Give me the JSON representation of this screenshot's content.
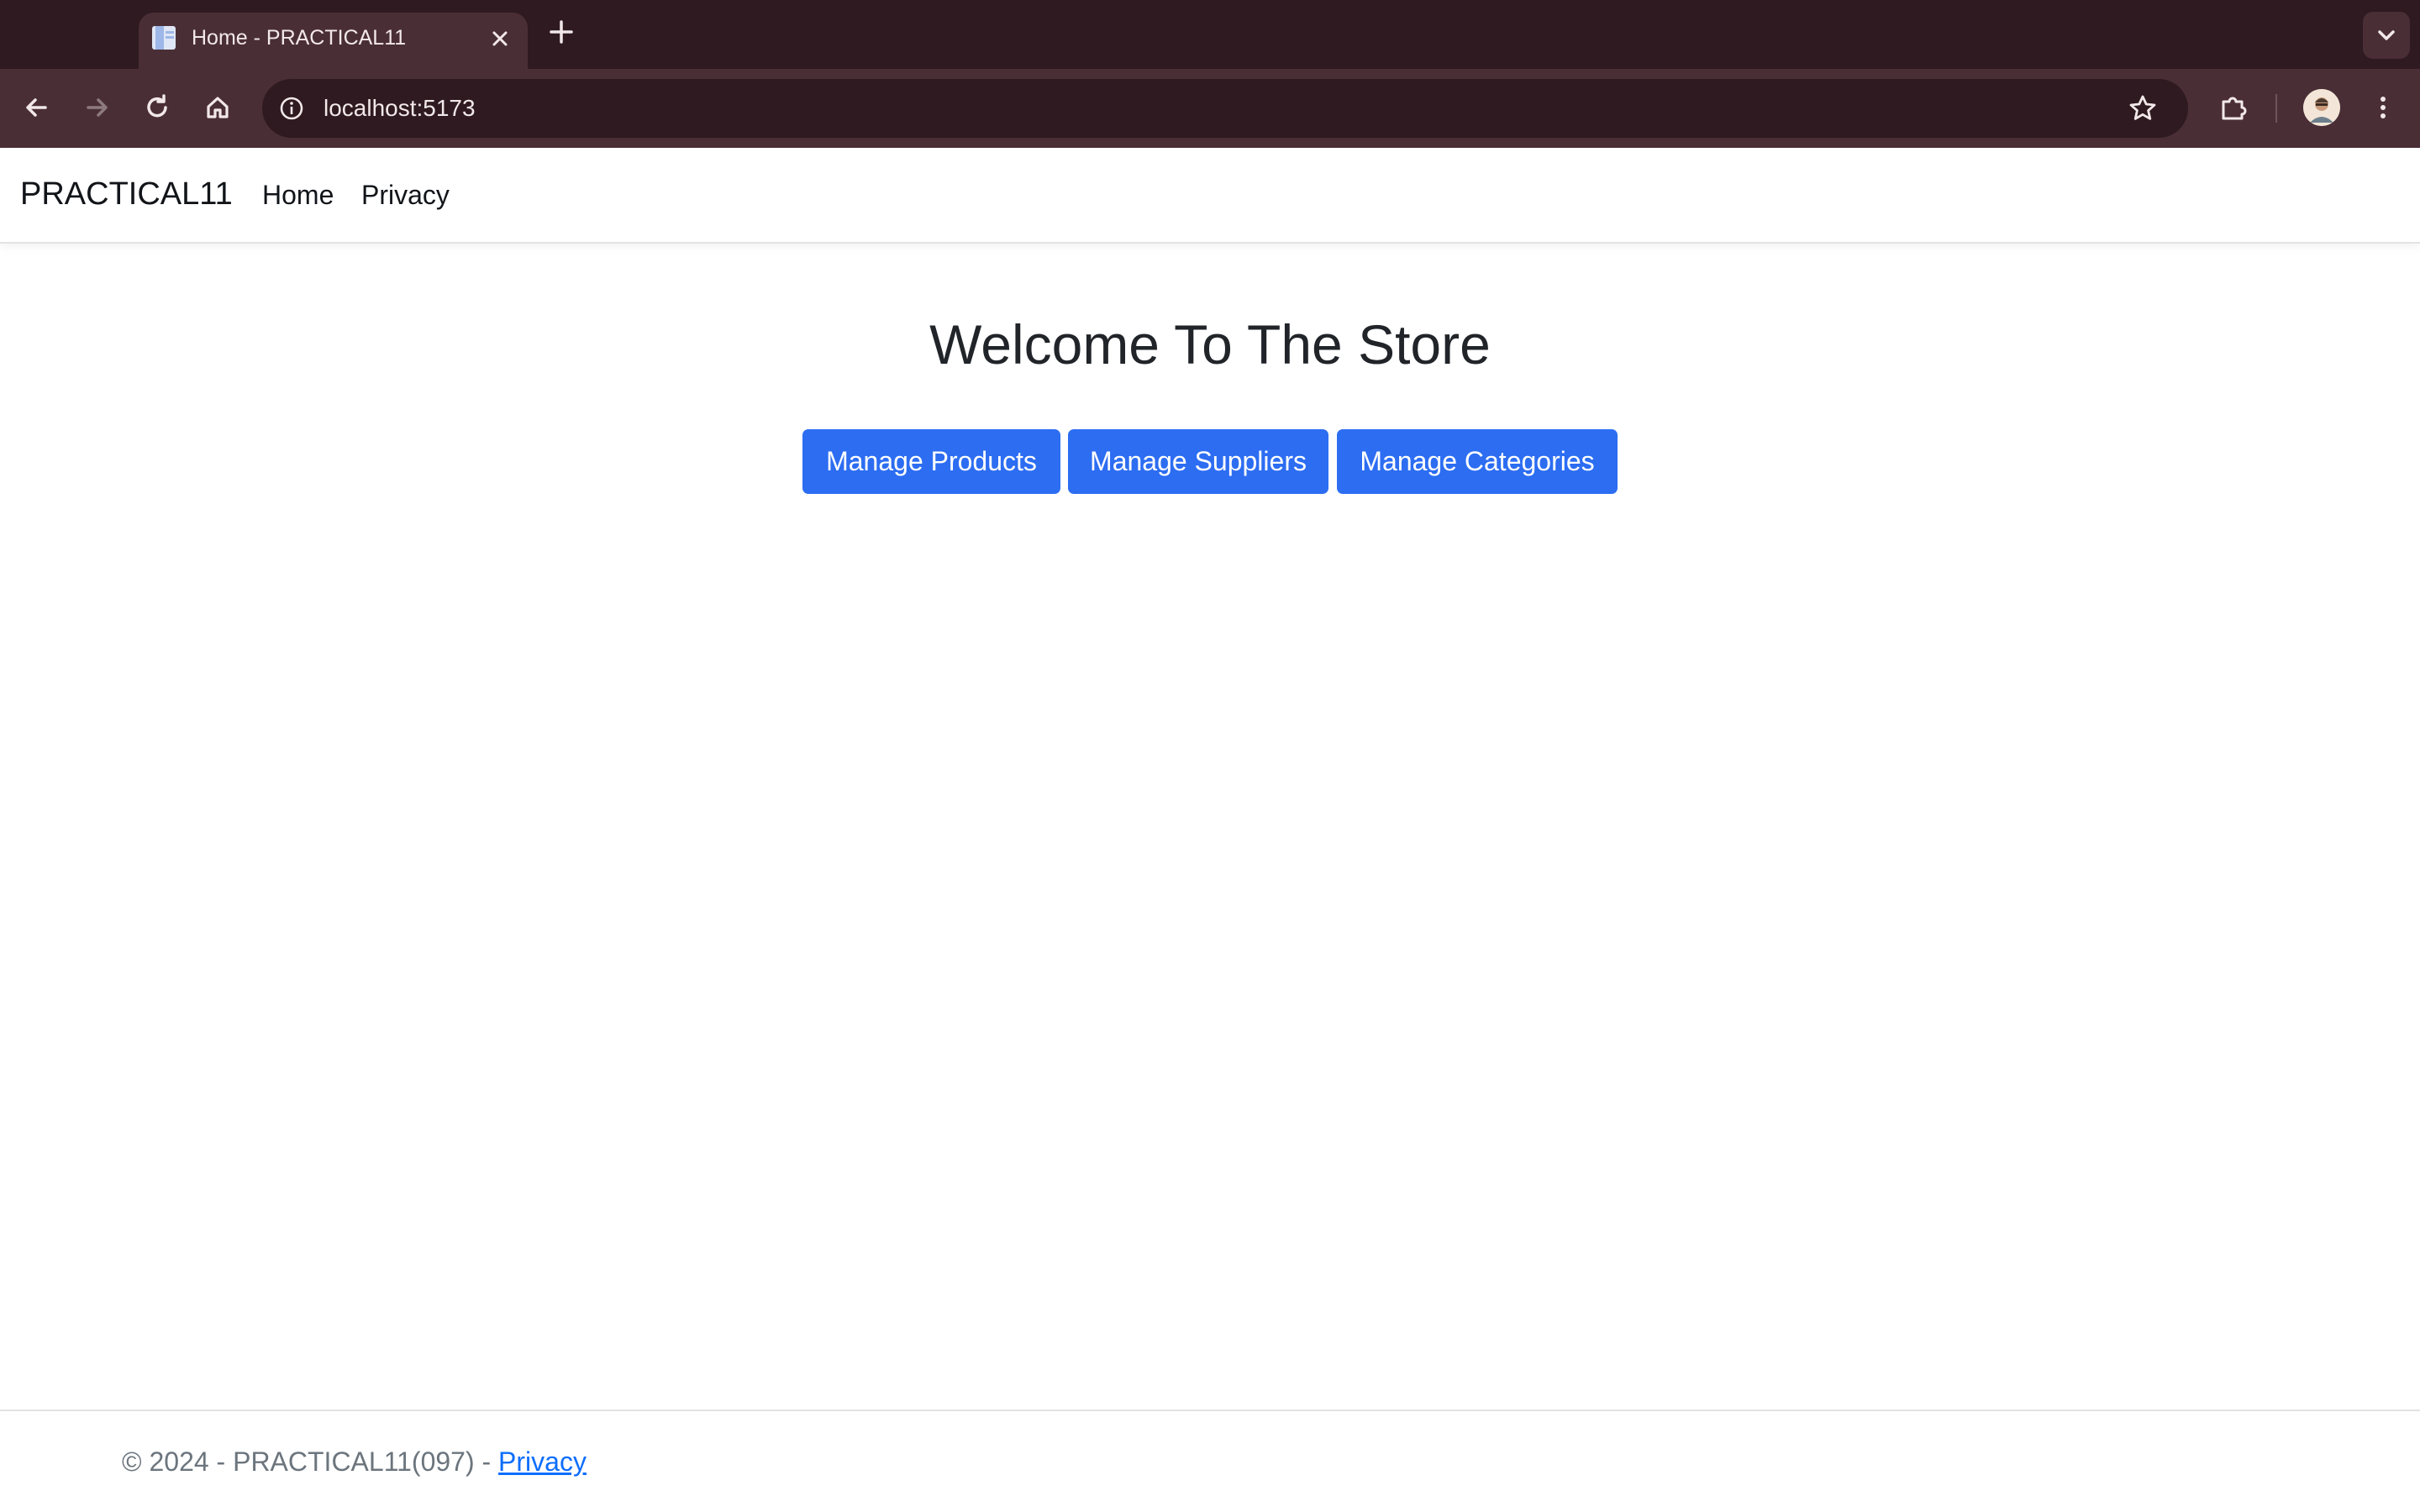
{
  "browser": {
    "tab": {
      "title": "Home - PRACTICAL11",
      "favicon": "page-icon",
      "close_icon": "close-icon"
    },
    "new_tab_icon": "plus-icon",
    "tab_search_icon": "chevron-down-icon",
    "toolbar": {
      "back_icon": "arrow-left-icon",
      "forward_icon": "arrow-right-icon",
      "reload_icon": "reload-icon",
      "home_icon": "home-icon",
      "site_info_icon": "info-icon",
      "url": "localhost:5173",
      "bookmark_icon": "star-icon",
      "extensions_icon": "puzzle-icon",
      "profile_icon": "avatar",
      "menu_icon": "kebab-menu-icon"
    },
    "colors": {
      "tabstrip": "#2e1a20",
      "toolbar": "#4a2e36"
    }
  },
  "page": {
    "navbar": {
      "brand": "PRACTICAL11",
      "links": [
        {
          "label": "Home"
        },
        {
          "label": "Privacy"
        }
      ]
    },
    "heading": "Welcome To The Store",
    "buttons": [
      {
        "label": "Manage Products"
      },
      {
        "label": "Manage Suppliers"
      },
      {
        "label": "Manage Categories"
      }
    ],
    "footer": {
      "text": "© 2024 - PRACTICAL11(097) - ",
      "link_label": "Privacy"
    },
    "colors": {
      "primary": "#2c6df2",
      "link": "#0d6efd",
      "heading": "#212529",
      "muted": "#6c757d"
    }
  }
}
